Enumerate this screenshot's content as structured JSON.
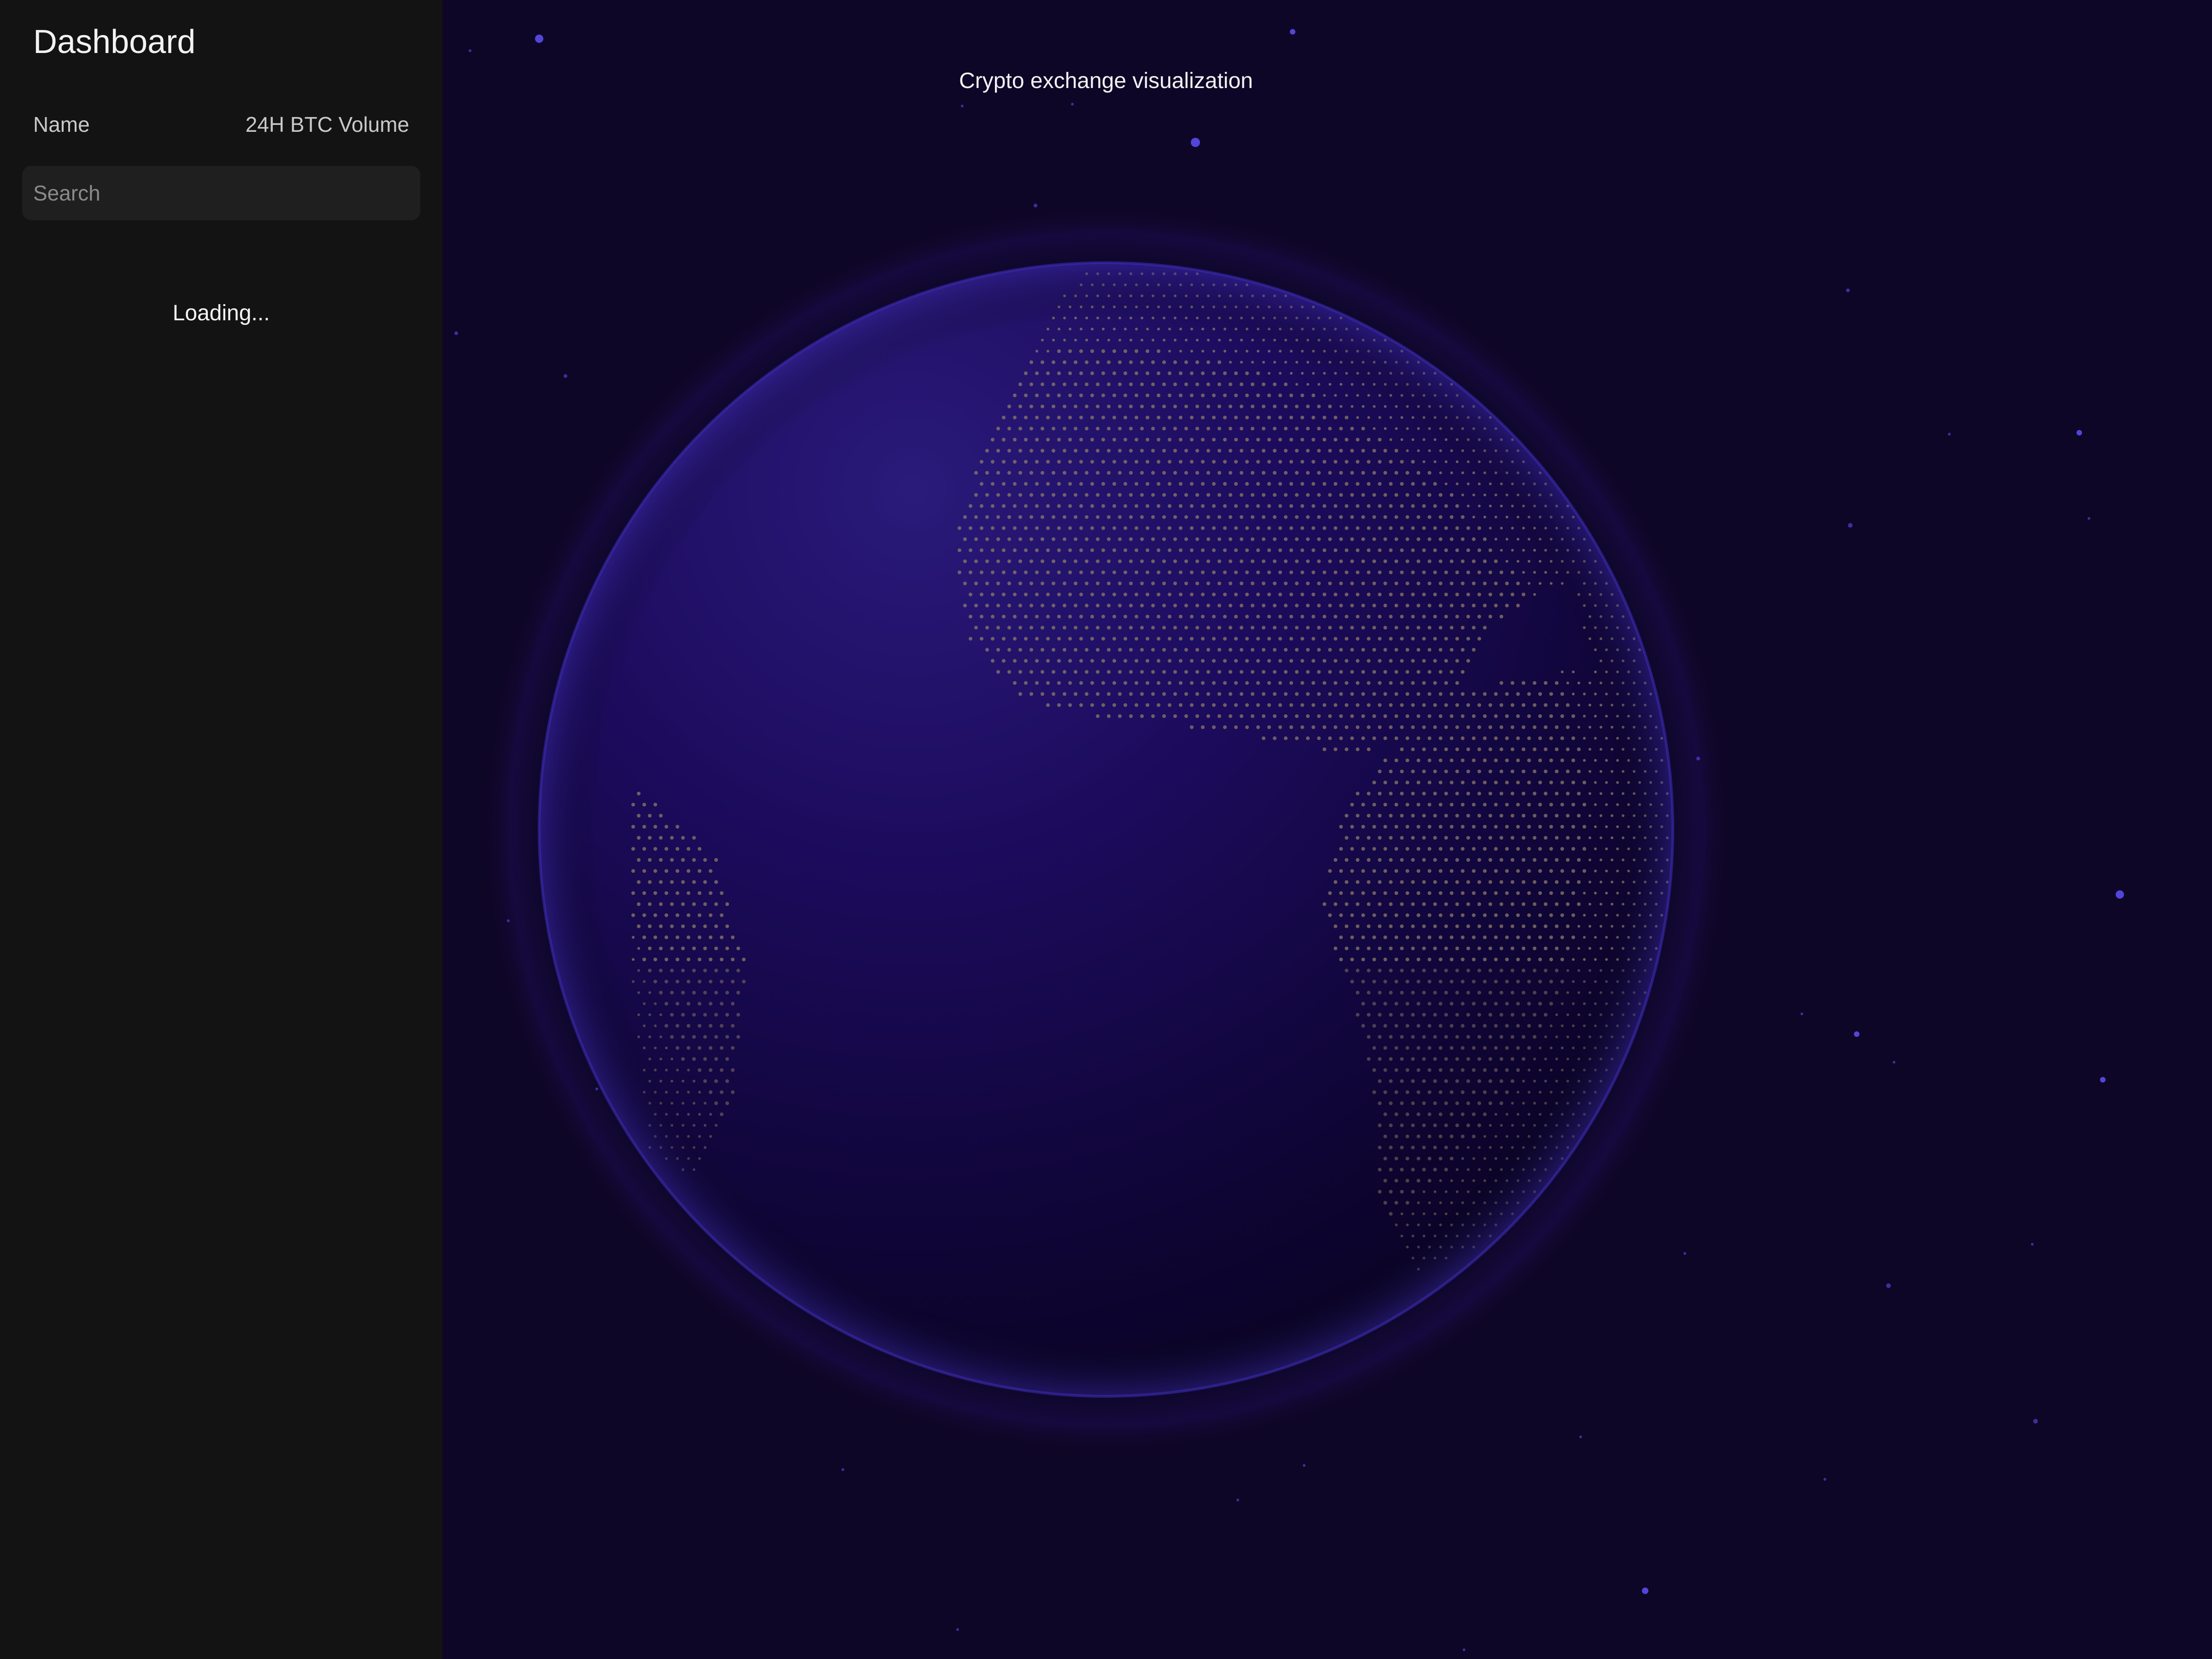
{
  "sidebar": {
    "title": "Dashboard",
    "columns": {
      "name": "Name",
      "volume": "24H BTC Volume"
    },
    "search": {
      "placeholder": "Search",
      "value": ""
    },
    "status": "Loading..."
  },
  "main": {
    "title": "Crypto exchange visualization",
    "globe_icon": "earth-globe",
    "colors": {
      "background": "#0e0626",
      "globe": "#1c0c5e",
      "dots": "#8a7a6a",
      "stars": "#5b4bff",
      "sidebar": "#131313"
    }
  }
}
